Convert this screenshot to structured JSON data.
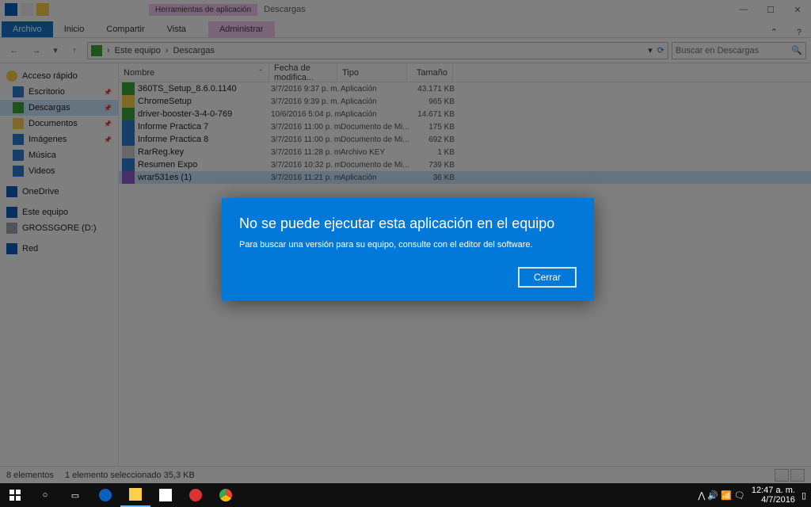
{
  "window": {
    "context_tab": "Herramientas de aplicación",
    "app_title": "Descargas",
    "tabs": {
      "file": "Archivo",
      "home": "Inicio",
      "share": "Compartir",
      "view": "Vista",
      "manage": "Administrar"
    },
    "win_min": "—",
    "win_max": "☐",
    "win_close": "✕"
  },
  "addr": {
    "root": "Este equipo",
    "sep": "›",
    "folder": "Descargas",
    "search_placeholder": "Buscar en Descargas"
  },
  "sidebar": {
    "quick": "Acceso rápido",
    "desktop": "Escritorio",
    "downloads": "Descargas",
    "documents": "Documentos",
    "pictures": "Imágenes",
    "music": "Música",
    "videos": "Videos",
    "onedrive": "OneDrive",
    "thispc": "Este equipo",
    "drive": "GROSSGORE (D:)",
    "network": "Red"
  },
  "columns": {
    "name": "Nombre",
    "date": "Fecha de modifica...",
    "type": "Tipo",
    "size": "Tamaño"
  },
  "files": [
    {
      "name": "360TS_Setup_8.6.0.1140",
      "date": "3/7/2016 9:37 p. m.",
      "type": "Aplicación",
      "size": "43.171 KB",
      "icon": "#3ba93b"
    },
    {
      "name": "ChromeSetup",
      "date": "3/7/2016 9:39 p. m.",
      "type": "Aplicación",
      "size": "965 KB",
      "icon": "#ffcf4b"
    },
    {
      "name": "driver-booster-3-4-0-769",
      "date": "10/6/2016 5:04 p. m.",
      "type": "Aplicación",
      "size": "14.671 KB",
      "icon": "#3ba93b"
    },
    {
      "name": "Informe Practica 7",
      "date": "3/7/2016 11:00 p. m.",
      "type": "Documento de Mi...",
      "size": "175 KB",
      "icon": "#2b7cd3"
    },
    {
      "name": "Informe Practica 8",
      "date": "3/7/2016 11:00 p. m.",
      "type": "Documento de Mi...",
      "size": "692 KB",
      "icon": "#2b7cd3"
    },
    {
      "name": "RarReg.key",
      "date": "3/7/2016 11:28 p. m.",
      "type": "Archivo KEY",
      "size": "1 KB",
      "icon": "#cfcfcf"
    },
    {
      "name": "Resumen Expo",
      "date": "3/7/2016 10:32 p. m.",
      "type": "Documento de Mi...",
      "size": "739 KB",
      "icon": "#2b7cd3"
    },
    {
      "name": "wrar531es (1)",
      "date": "3/7/2016 11:21 p. m.",
      "type": "Aplicación",
      "size": "36 KB",
      "icon": "#8e5bd4",
      "selected": true
    }
  ],
  "status": {
    "count": "8 elementos",
    "selection": "1 elemento seleccionado 35,3 KB"
  },
  "dialog": {
    "title": "No se puede ejecutar esta aplicación en el equipo",
    "body": "Para buscar una versión para su equipo, consulte con el editor del software.",
    "close": "Cerrar"
  },
  "taskbar": {
    "tray": "⋀ 🔊 📶 🗨",
    "time": "12:47 a. m.",
    "date": "4/7/2016"
  }
}
